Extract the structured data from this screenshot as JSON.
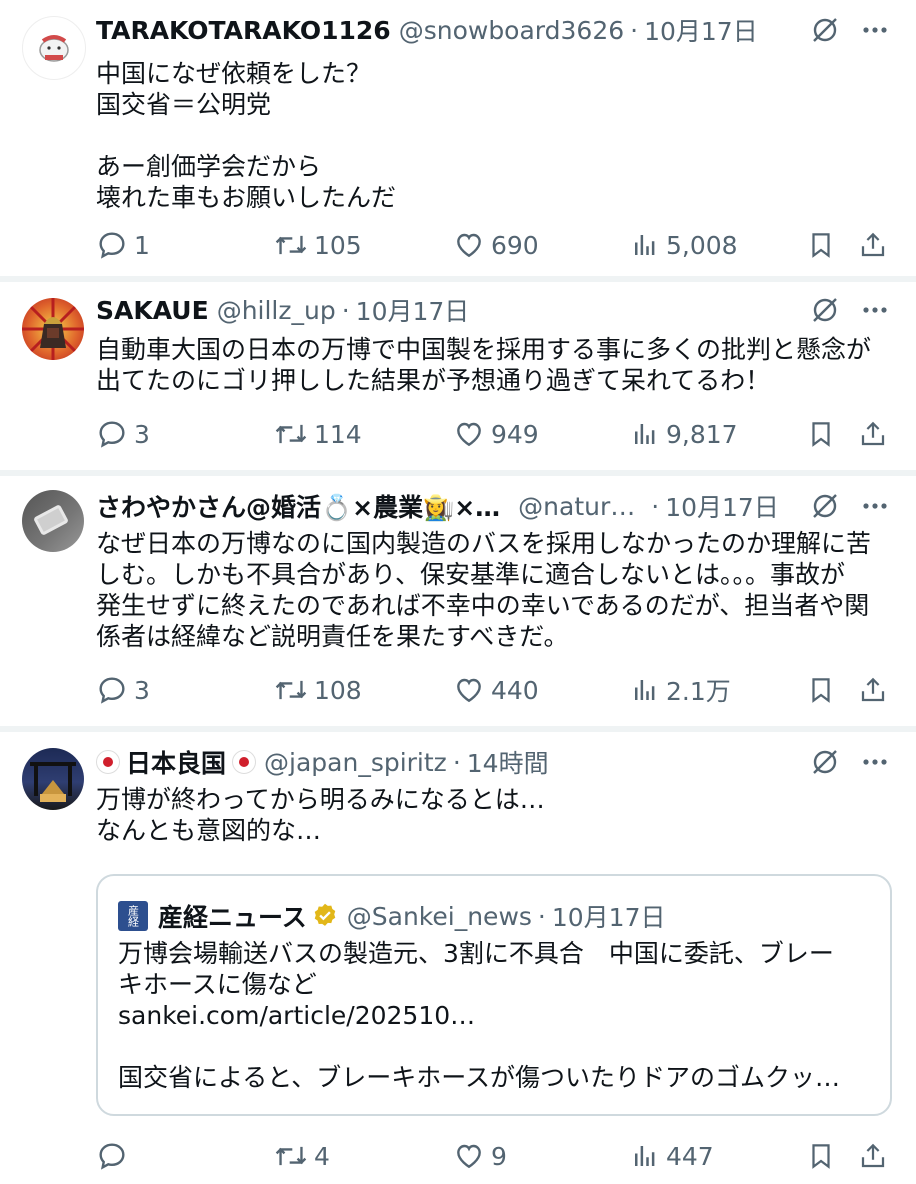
{
  "tweets": [
    {
      "name": "TARAKOTARAKO1126",
      "handle": "@snowboard3626",
      "sep": "·",
      "date": "10月17日",
      "text": "中国になぜ依頼をした？\n国交省＝公明党\n\nあー創価学会だから\n壊れた車もお願いしたんだ",
      "replies": "1",
      "retweets": "105",
      "likes": "690",
      "views": "5,008"
    },
    {
      "name": "SAKAUE",
      "handle": "@hillz_up",
      "sep": "·",
      "date": "10月17日",
      "text": "自動車大国の日本の万博で中国製を採用する事に多くの批判と懸念が\n出てたのにゴリ押しした結果が予想通り過ぎて呆れてるわ！",
      "replies": "3",
      "retweets": "114",
      "likes": "949",
      "views": "9,817"
    },
    {
      "name": "さわやかさん@婚活💍×農業👩‍🌾×…",
      "handle": "@natur…",
      "sep": "·",
      "date": "10月17日",
      "text": "なぜ日本の万博なのに国内製造のバスを採用しなかったのか理解に苦\nしむ。しかも不具合があり、保安基準に適合しないとは。。。事故が\n発生せずに終えたのであれば不幸中の幸いであるのだが、担当者や関\n係者は経緯など説明責任を果たすべきだ。",
      "replies": "3",
      "retweets": "108",
      "likes": "440",
      "views": "2.1万"
    },
    {
      "name": "日本良国",
      "handle": "@japan_spiritz",
      "sep": "·",
      "date": "14時間",
      "text": "万博が終わってから明るみになるとは…\nなんとも意図的な…",
      "replies": "",
      "retweets": "4",
      "likes": "9",
      "views": "447",
      "quote": {
        "name": "産経ニュース",
        "handle": "@Sankei_news",
        "sep": "·",
        "date": "10月17日",
        "text": "万博会場輸送バスの製造元、3割に不具合　中国に委託、ブレー\nキホースに傷など\nsankei.com/article/202510…\n\n国交省によると、ブレーキホースが傷ついたりドアのゴムクッ…",
        "logo_text": "産経"
      }
    }
  ],
  "colors": {
    "text": "#0f1419",
    "secondary": "#536471",
    "divider": "#eff3f4",
    "verified": "#e2b719"
  }
}
